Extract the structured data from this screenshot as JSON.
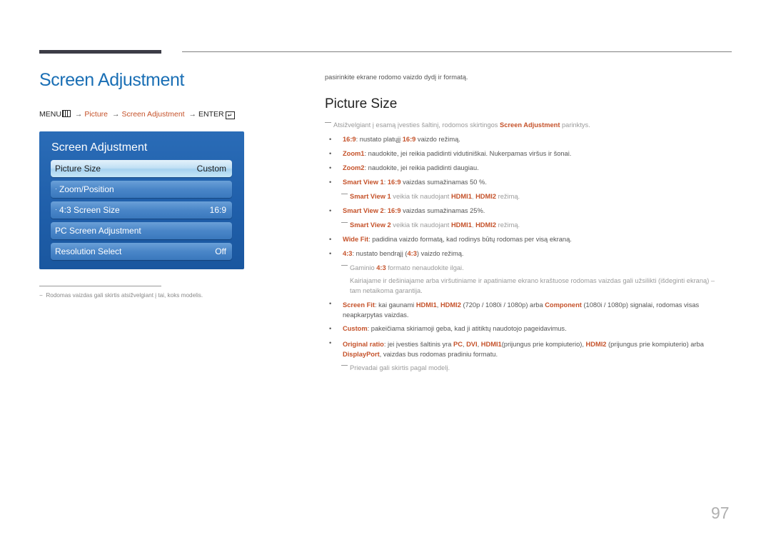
{
  "page": {
    "title": "Screen Adjustment",
    "page_number": "97"
  },
  "menu_path": {
    "menu": "MENU",
    "menu_icon": "menu-icon",
    "arrow": "→",
    "picture": "Picture",
    "screen_adjustment": "Screen Adjustment",
    "enter": "ENTER",
    "enter_icon": "enter-icon"
  },
  "osd": {
    "title": "Screen Adjustment",
    "items": [
      {
        "label": "Picture Size",
        "value": "Custom",
        "selected": true,
        "sub": false
      },
      {
        "label": "Zoom/Position",
        "value": "",
        "selected": false,
        "sub": true
      },
      {
        "label": "4:3 Screen Size",
        "value": "16:9",
        "selected": false,
        "sub": true
      },
      {
        "label": "PC Screen Adjustment",
        "value": "",
        "selected": false,
        "sub": false
      },
      {
        "label": "Resolution Select",
        "value": "Off",
        "selected": false,
        "sub": false
      }
    ],
    "sub_marker": "·"
  },
  "footnote": {
    "marker": "−",
    "text": "Rodomas vaizdas gali skirtis atsižvelgiant į tai, koks modelis."
  },
  "content": {
    "intro": "pasirinkite ekrane rodomo vaizdo dydį ir formatą.",
    "heading": "Picture Size",
    "note0": {
      "pre": "Atsižvelgiant į esamą įvesties šaltinį, rodomos skirtingos ",
      "hl": "Screen Adjustment",
      "post": " parinktys."
    },
    "bullet_char": "•",
    "b1": {
      "h1": "16:9",
      "t1": ": nustato platųjį ",
      "h2": "16:9",
      "t2": " vaizdo režimą."
    },
    "b2": {
      "h1": "Zoom1",
      "t1": ": naudokite, jei reikia padidinti vidutiniškai. Nukerpamas viršus ir šonai."
    },
    "b3": {
      "h1": "Zoom2",
      "t1": ": naudokite, jei reikia padidinti daugiau."
    },
    "b4": {
      "h1": "Smart View 1",
      "t1": ": ",
      "h2": "16:9",
      "t2": " vaizdas sumažinamas 50 %."
    },
    "n4": {
      "h1": "Smart View 1",
      "t1": " veikia tik naudojant ",
      "h2": "HDMI1",
      "t2": ", ",
      "h3": "HDMI2",
      "t3": " režimą."
    },
    "b5": {
      "h1": "Smart View 2",
      "t1": ": ",
      "h2": "16:9",
      "t2": " vaizdas sumažinamas 25%."
    },
    "n5": {
      "h1": "Smart View 2",
      "t1": " veikia tik naudojant ",
      "h2": "HDMI1",
      "t2": ", ",
      "h3": "HDMI2",
      "t3": " režimą."
    },
    "b6": {
      "h1": "Wide Fit",
      "t1": ": padidina vaizdo formatą, kad rodinys būtų rodomas per visą ekraną."
    },
    "b7": {
      "h1": "4:3",
      "t1": ": nustato bendrąjį (",
      "h2": "4:3",
      "t2": ") vaizdo režimą."
    },
    "n7": {
      "t0": "Gaminio ",
      "h1": "4:3",
      "t1": " formato nenaudokite ilgai."
    },
    "n7b": "Kairiajame ir dešiniajame arba viršutiniame ir apatiniame ekrano kraštuose rodomas vaizdas gali užsilikti (išdeginti ekraną) – tam netaikoma garantija.",
    "b8": {
      "h1": "Screen Fit",
      "t1": ": kai gaunami ",
      "h2": "HDMI1",
      "t2": ", ",
      "h3": "HDMI2",
      "t3": " (720p / 1080i / 1080p) arba ",
      "h4": "Component",
      "t4": " (1080i / 1080p) signalai, rodomas visas neapkarpytas vaizdas."
    },
    "b9": {
      "h1": "Custom",
      "t1": ": pakeičiama skiriamoji geba, kad ji atitiktų naudotojo pageidavimus."
    },
    "b10": {
      "h1": "Original ratio",
      "t1": ": jei įvesties šaltinis yra ",
      "h2": "PC",
      "t2": ", ",
      "h3": "DVI",
      "t3": ", ",
      "h4": "HDMI1",
      "t4": "(prijungus prie kompiuterio), ",
      "h5": "HDMI2",
      "t5": " (prijungus prie kompiuterio) arba ",
      "h6": "DisplayPort",
      "t6": ", vaizdas bus rodomas pradiniu formatu."
    },
    "n10": "Prievadai gali skirtis pagal modelį."
  }
}
